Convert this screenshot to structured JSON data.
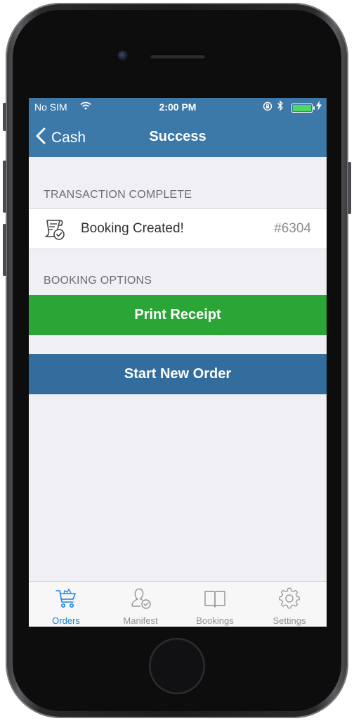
{
  "status_bar": {
    "carrier": "No SIM",
    "time": "2:00 PM",
    "battery_color": "#4cd964"
  },
  "nav": {
    "back_label": "Cash",
    "title": "Success"
  },
  "sections": {
    "transaction_header": "TRANSACTION COMPLETE",
    "booking_row": {
      "label": "Booking Created!",
      "number": "#6304",
      "icon": "receipt-check-icon"
    },
    "options_header": "BOOKING OPTIONS"
  },
  "buttons": {
    "print_receipt": "Print Receipt",
    "start_new_order": "Start New Order"
  },
  "tabs": [
    {
      "label": "Orders",
      "icon": "cart-icon",
      "active": true
    },
    {
      "label": "Manifest",
      "icon": "person-check-icon",
      "active": false
    },
    {
      "label": "Bookings",
      "icon": "book-icon",
      "active": false
    },
    {
      "label": "Settings",
      "icon": "gear-icon",
      "active": false
    }
  ],
  "colors": {
    "nav_bar": "#3c78a8",
    "print_button": "#2aa536",
    "new_order_button": "#336d9d",
    "active_tab": "#1a82e8"
  }
}
